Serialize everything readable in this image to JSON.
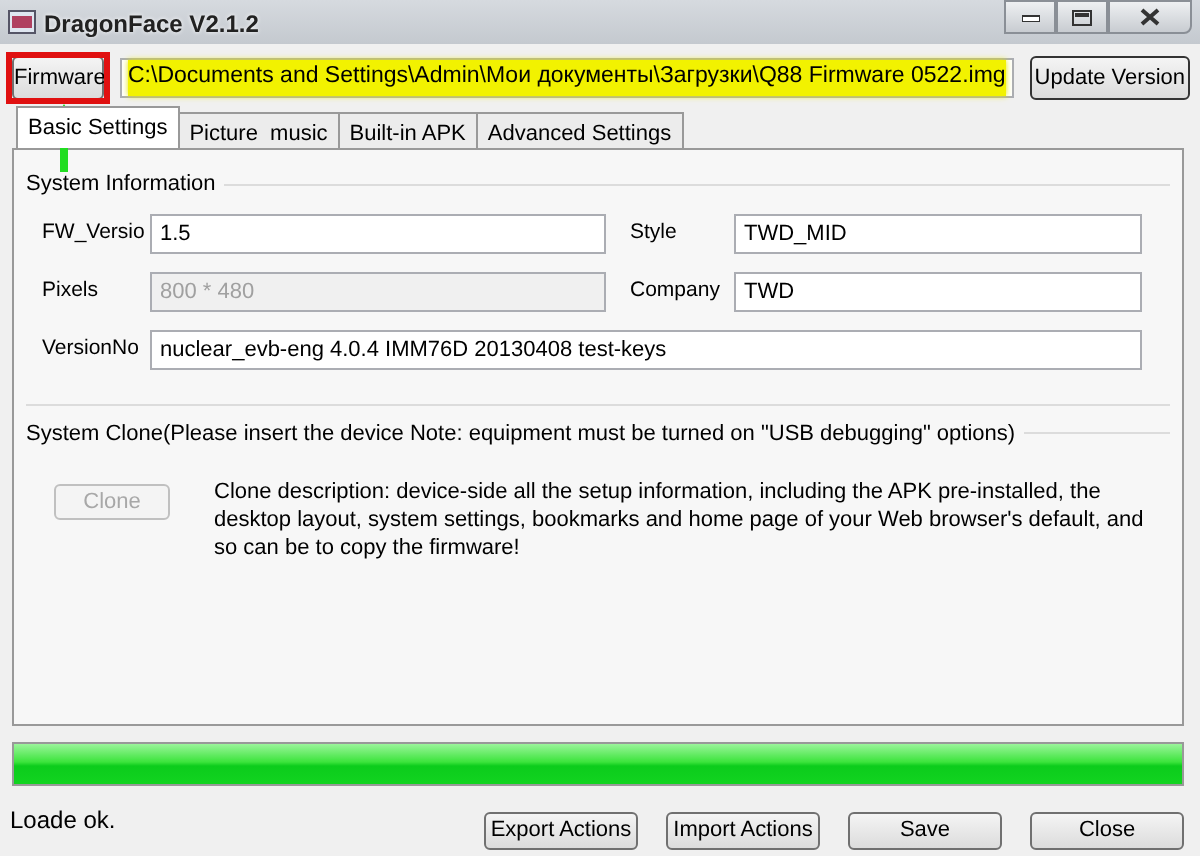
{
  "window": {
    "title": "DragonFace V2.1.2"
  },
  "firmware_button": "Firmware",
  "firmware_path": "C:\\Documents and Settings\\Admin\\Мои документы\\Загрузки\\Q88 Firmware 0522.img",
  "update_button": "Update Version",
  "tabs": [
    {
      "label": "Basic Settings",
      "selected": true
    },
    {
      "label": "Picture  music",
      "selected": false
    },
    {
      "label": "Built-in APK",
      "selected": false
    },
    {
      "label": "Advanced Settings",
      "selected": false
    }
  ],
  "system_information": {
    "title": "System Information",
    "rows": [
      [
        {
          "label": "FW_Versio",
          "value": "1.5",
          "disabled": false
        },
        {
          "label": "Style",
          "value": "TWD_MID",
          "disabled": false
        }
      ],
      [
        {
          "label": "Pixels",
          "value": "800 * 480",
          "disabled": true
        },
        {
          "label": "Company",
          "value": "TWD",
          "disabled": false
        }
      ],
      [
        {
          "label": "VersionNo",
          "value": "nuclear_evb-eng 4.0.4 IMM76D 20130408 test-keys",
          "disabled": false
        }
      ]
    ]
  },
  "system_clone": {
    "title": "System Clone(Please insert the device Note: equipment must be turned on \"USB debugging\" options)",
    "clone_button": {
      "label": "Clone",
      "disabled": true
    },
    "description": "Clone description: device-side all the setup information, including the APK pre-installed, the desktop layout, system settings, bookmarks and home page of your Web browser's default, and so can be to copy the firmware!"
  },
  "progress": {
    "level": 1
  },
  "status": "Loade ok.",
  "buttons": [
    "Export Actions",
    "Import Actions",
    "Save",
    "Close"
  ]
}
